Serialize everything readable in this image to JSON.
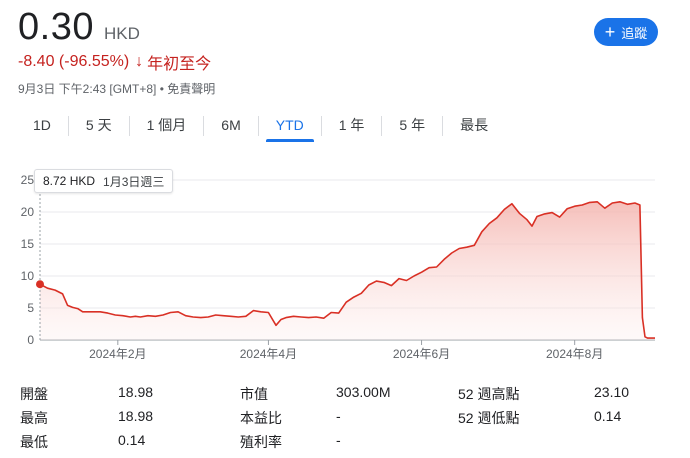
{
  "quote": {
    "price": "0.30",
    "currency": "HKD",
    "change": "-8.40 (-96.55%)",
    "change_arrow": "↓",
    "period": "年初至今",
    "timestamp": "9月3日 下午2:43 [GMT+8]",
    "separator": " • ",
    "disclaimer": "免責聲明"
  },
  "follow_button": {
    "icon": "plus-icon",
    "label": "追蹤"
  },
  "tabs": [
    {
      "label": "1D",
      "active": false
    },
    {
      "label": "5 天",
      "active": false
    },
    {
      "label": "1 個月",
      "active": false
    },
    {
      "label": "6M",
      "active": false
    },
    {
      "label": "YTD",
      "active": true
    },
    {
      "label": "1 年",
      "active": false
    },
    {
      "label": "5 年",
      "active": false
    },
    {
      "label": "最長",
      "active": false
    }
  ],
  "tooltip": {
    "price": "8.72 HKD",
    "date": "1月3日週三"
  },
  "colors": {
    "accent": "#1a73e8",
    "down": "#d93025",
    "fill": "#fce8e6"
  },
  "chart_data": {
    "type": "area",
    "x_ticks": [
      "2024年2月",
      "2024年4月",
      "2024年6月",
      "2024年8月"
    ],
    "x_tick_days": [
      31,
      91,
      152,
      213
    ],
    "y_ticks": [
      "0",
      "5",
      "10",
      "15",
      "20",
      "25"
    ],
    "ylim": [
      0,
      25
    ],
    "xlim_days": [
      0,
      245
    ],
    "grid": true,
    "series": [
      {
        "days": [
          0,
          3,
          6,
          9,
          11,
          13,
          15,
          17,
          19,
          21,
          24,
          27,
          30,
          33,
          36,
          38,
          40,
          43,
          46,
          49,
          52,
          55,
          58,
          61,
          64,
          67,
          70,
          73,
          76,
          79,
          82,
          85,
          88,
          91,
          94,
          96,
          98,
          101,
          104,
          107,
          110,
          113,
          116,
          119,
          122,
          125,
          128,
          131,
          134,
          137,
          140,
          143,
          146,
          149,
          152,
          155,
          158,
          161,
          164,
          167,
          170,
          173,
          176,
          179,
          182,
          185,
          188,
          191,
          194,
          196,
          198,
          201,
          204,
          207,
          210,
          213,
          216,
          219,
          222,
          225,
          228,
          231,
          234,
          237,
          239,
          240,
          241,
          242,
          243,
          244,
          245
        ],
        "values": [
          8.72,
          8.1,
          7.8,
          7.2,
          5.4,
          5.1,
          4.9,
          4.4,
          4.4,
          4.4,
          4.4,
          4.2,
          3.9,
          3.8,
          3.6,
          3.7,
          3.6,
          3.8,
          3.7,
          3.9,
          4.3,
          4.4,
          3.8,
          3.6,
          3.5,
          3.6,
          3.9,
          3.8,
          3.7,
          3.6,
          3.7,
          4.6,
          4.4,
          4.3,
          2.3,
          3.2,
          3.5,
          3.7,
          3.6,
          3.5,
          3.6,
          3.4,
          4.3,
          4.2,
          5.9,
          6.7,
          7.3,
          8.6,
          9.2,
          9.0,
          8.5,
          9.6,
          9.3,
          10.0,
          10.6,
          11.3,
          11.4,
          12.6,
          13.6,
          14.3,
          14.5,
          14.8,
          16.9,
          18.2,
          19.1,
          20.4,
          21.3,
          19.8,
          18.8,
          17.8,
          19.3,
          19.7,
          19.9,
          19.2,
          20.5,
          20.9,
          21.1,
          21.5,
          21.6,
          20.6,
          21.4,
          21.6,
          21.2,
          21.4,
          21.1,
          3.5,
          0.5,
          0.3,
          0.3,
          0.3,
          0.3
        ]
      }
    ],
    "marker": {
      "day": 0,
      "value": 8.72
    }
  },
  "stats": [
    [
      {
        "label": "開盤",
        "value": "18.98"
      },
      {
        "label": "市值",
        "value": "303.00M"
      },
      {
        "label": "52 週高點",
        "value": "23.10"
      }
    ],
    [
      {
        "label": "最高",
        "value": "18.98"
      },
      {
        "label": "本益比",
        "value": "-"
      },
      {
        "label": "52 週低點",
        "value": "0.14"
      }
    ],
    [
      {
        "label": "最低",
        "value": "0.14"
      },
      {
        "label": "殖利率",
        "value": "-"
      },
      {
        "label": "",
        "value": ""
      }
    ]
  ]
}
